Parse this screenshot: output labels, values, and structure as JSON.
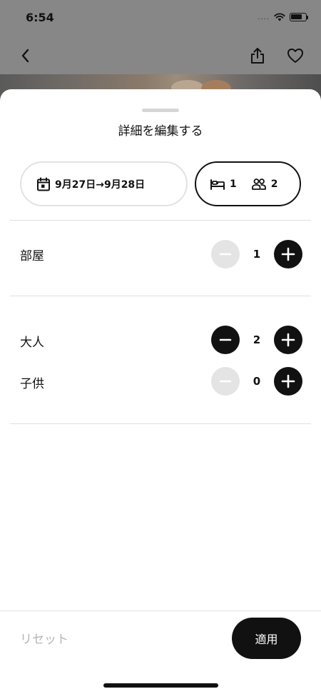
{
  "status_bar": {
    "time": "6:54",
    "signal": "....",
    "icons": [
      "wifi-icon",
      "battery-icon"
    ]
  },
  "nav": {
    "icons": [
      "chevron-left-icon",
      "share-icon",
      "heart-icon"
    ]
  },
  "sheet": {
    "title": "詳細を編集する",
    "dates_pill": {
      "icon": "calendar-icon",
      "label": "9月27日→9月28日"
    },
    "guests_pill": {
      "bed_icon": "bed-icon",
      "rooms": "1",
      "people_icon": "people-icon",
      "guests": "2"
    },
    "rows": {
      "rooms": {
        "label": "部屋",
        "value": "1",
        "minus_enabled": false,
        "plus_enabled": true
      },
      "adults": {
        "label": "大人",
        "value": "2",
        "minus_enabled": true,
        "plus_enabled": true
      },
      "children": {
        "label": "子供",
        "value": "0",
        "minus_enabled": false,
        "plus_enabled": true
      }
    }
  },
  "footer": {
    "reset_label": "リセット",
    "apply_label": "適用"
  },
  "colors": {
    "accent": "#111111",
    "disabled": "#e4e4e4",
    "disabled_text": "#b5b5b5",
    "divider": "#e0e0e0",
    "backdrop": "#878787"
  }
}
